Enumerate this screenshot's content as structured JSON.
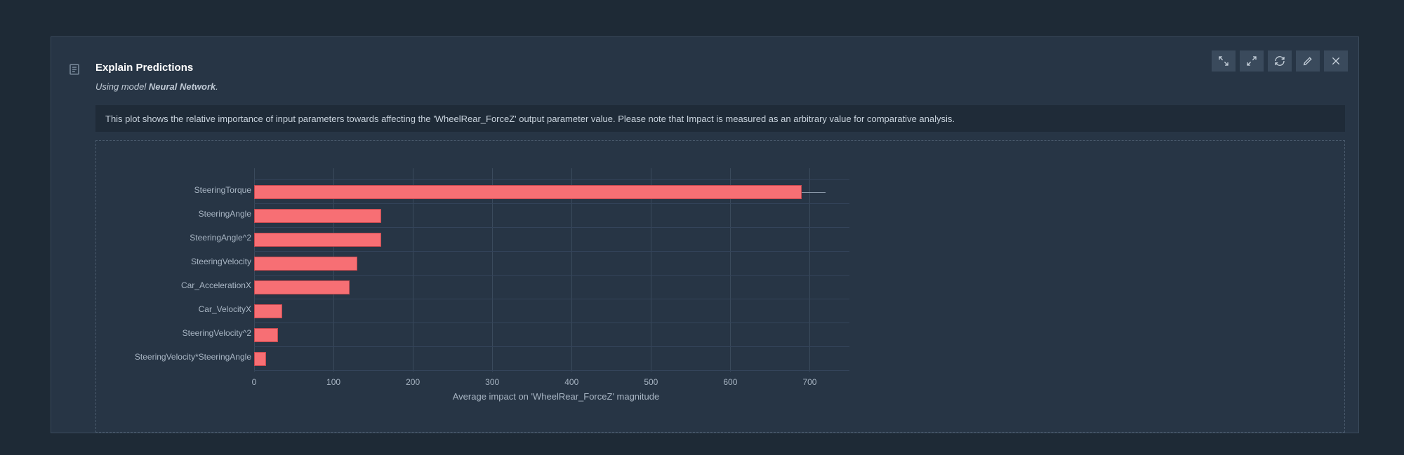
{
  "header": {
    "title": "Explain Predictions",
    "subtitle_prefix": "Using model ",
    "subtitle_model": "Neural Network",
    "subtitle_suffix": "."
  },
  "toolbar": {
    "collapse": "collapse",
    "expand": "expand",
    "refresh": "refresh",
    "edit": "edit",
    "close": "close"
  },
  "description": "This plot shows the relative importance of input parameters towards affecting the 'WheelRear_ForceZ' output parameter value. Please note that Impact is measured as an arbitrary value for comparative analysis.",
  "chart_data": {
    "type": "bar",
    "orientation": "horizontal",
    "xlabel": "Average impact on 'WheelRear_ForceZ' magnitude",
    "xlim": [
      0,
      750
    ],
    "xticks": [
      0,
      100,
      200,
      300,
      400,
      500,
      600,
      700
    ],
    "categories": [
      "SteeringTorque",
      "SteeringAngle",
      "SteeringAngle^2",
      "SteeringVelocity",
      "Car_AccelerationX",
      "Car_VelocityX",
      "SteeringVelocity^2",
      "SteeringVelocity*SteeringAngle"
    ],
    "values": [
      690,
      160,
      160,
      130,
      120,
      35,
      30,
      15
    ],
    "error_upper": [
      30,
      0,
      0,
      0,
      0,
      0,
      0,
      0
    ],
    "bar_color": "#f76f74"
  }
}
